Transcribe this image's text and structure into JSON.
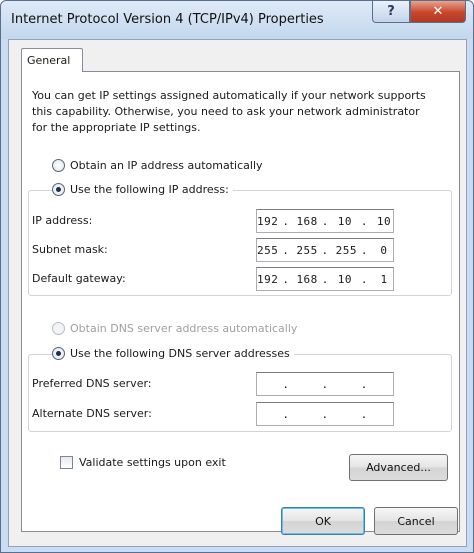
{
  "window": {
    "title": "Internet Protocol Version 4 (TCP/IPv4) Properties",
    "help_glyph": "?",
    "close_glyph": "✕"
  },
  "tabs": [
    {
      "label": "General"
    }
  ],
  "description": "You can get IP settings assigned automatically if your network supports this capability. Otherwise, you need to ask your network administrator for the appropriate IP settings.",
  "ip_section": {
    "auto_label": "Obtain an IP address automatically",
    "manual_label": "Use the following IP address:",
    "selected": "manual",
    "fields": [
      {
        "label": "IP address:",
        "octets": [
          "192",
          "168",
          "10",
          "10"
        ]
      },
      {
        "label": "Subnet mask:",
        "octets": [
          "255",
          "255",
          "255",
          "0"
        ]
      },
      {
        "label": "Default gateway:",
        "octets": [
          "192",
          "168",
          "10",
          "1"
        ]
      }
    ]
  },
  "dns_section": {
    "auto_label": "Obtain DNS server address automatically",
    "manual_label": "Use the following DNS server addresses",
    "selected": "manual",
    "auto_disabled": true,
    "fields": [
      {
        "label": "Preferred DNS server:",
        "octets": [
          "",
          "",
          "",
          ""
        ]
      },
      {
        "label": "Alternate DNS server:",
        "octets": [
          "",
          "",
          "",
          ""
        ]
      }
    ]
  },
  "validate": {
    "label": "Validate settings upon exit",
    "checked": false
  },
  "buttons": {
    "advanced": "Advanced...",
    "ok": "OK",
    "cancel": "Cancel"
  },
  "colors": {
    "title_bar": "#c9dcf1",
    "close_button": "#c7462b",
    "default_button_border": "#3c7fb1"
  },
  "icons": {
    "help": "help-icon",
    "close": "close-icon"
  }
}
